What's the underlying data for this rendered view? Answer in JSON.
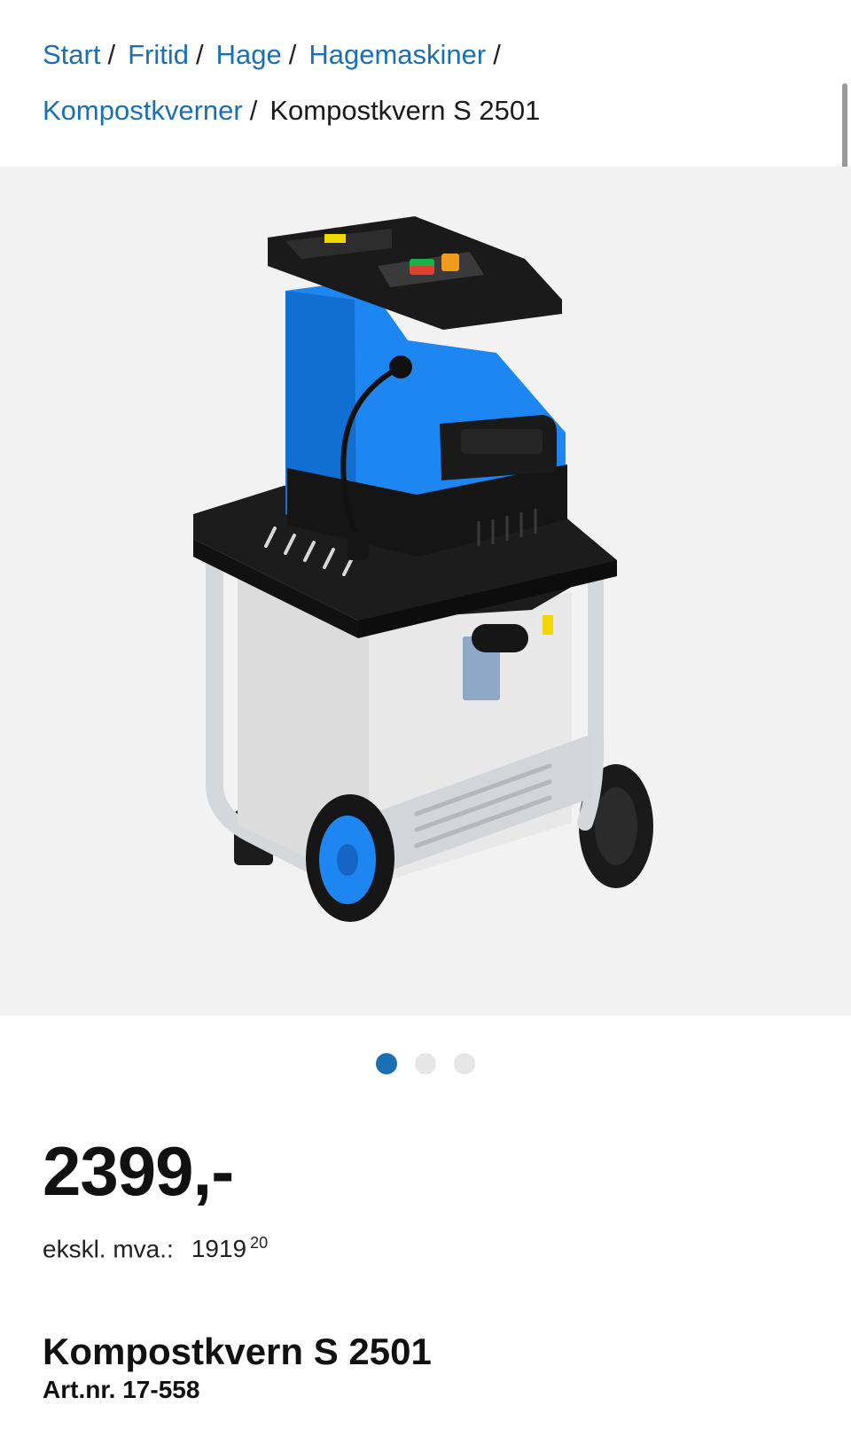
{
  "breadcrumb": {
    "links": [
      "Start",
      "Fritid",
      "Hage",
      "Hagemaskiner",
      "Kompostkverner"
    ],
    "separator": "/",
    "current": "Kompostkvern S 2501"
  },
  "gallery": {
    "image_subject": "Kompostkvern S 2501",
    "dot_count": 3,
    "active_index": 0
  },
  "price": {
    "amount": "2399,-",
    "vat_label": "ekskl. mva.:",
    "vat_value": "1919",
    "vat_decimals": "20"
  },
  "product": {
    "title": "Kompostkvern S 2501",
    "article_number": "Art.nr. 17-558"
  },
  "colors": {
    "link": "#1a6fb5",
    "gallery_bg": "#f2f2f2",
    "product_blue": "#1e86f0",
    "active_dot": "#1a6fb5"
  }
}
